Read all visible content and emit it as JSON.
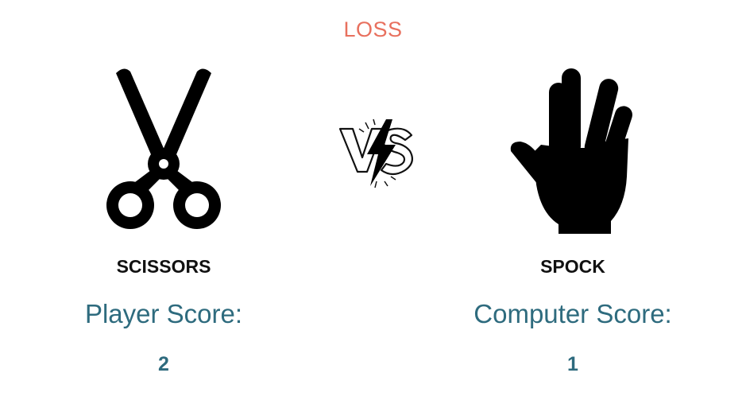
{
  "result": {
    "text": "LOSS",
    "color": "#e8705e"
  },
  "player": {
    "choice_icon": "scissors-icon",
    "choice_label": "SCISSORS",
    "score_label": "Player Score:",
    "score": "2"
  },
  "computer": {
    "choice_icon": "spock-hand-icon",
    "choice_label": "SPOCK",
    "score_label": "Computer Score:",
    "score": "1"
  },
  "versus": {
    "icon": "versus-lightning-icon"
  },
  "colors": {
    "score_text": "#2e6b7e",
    "icon_fill": "#000000"
  }
}
